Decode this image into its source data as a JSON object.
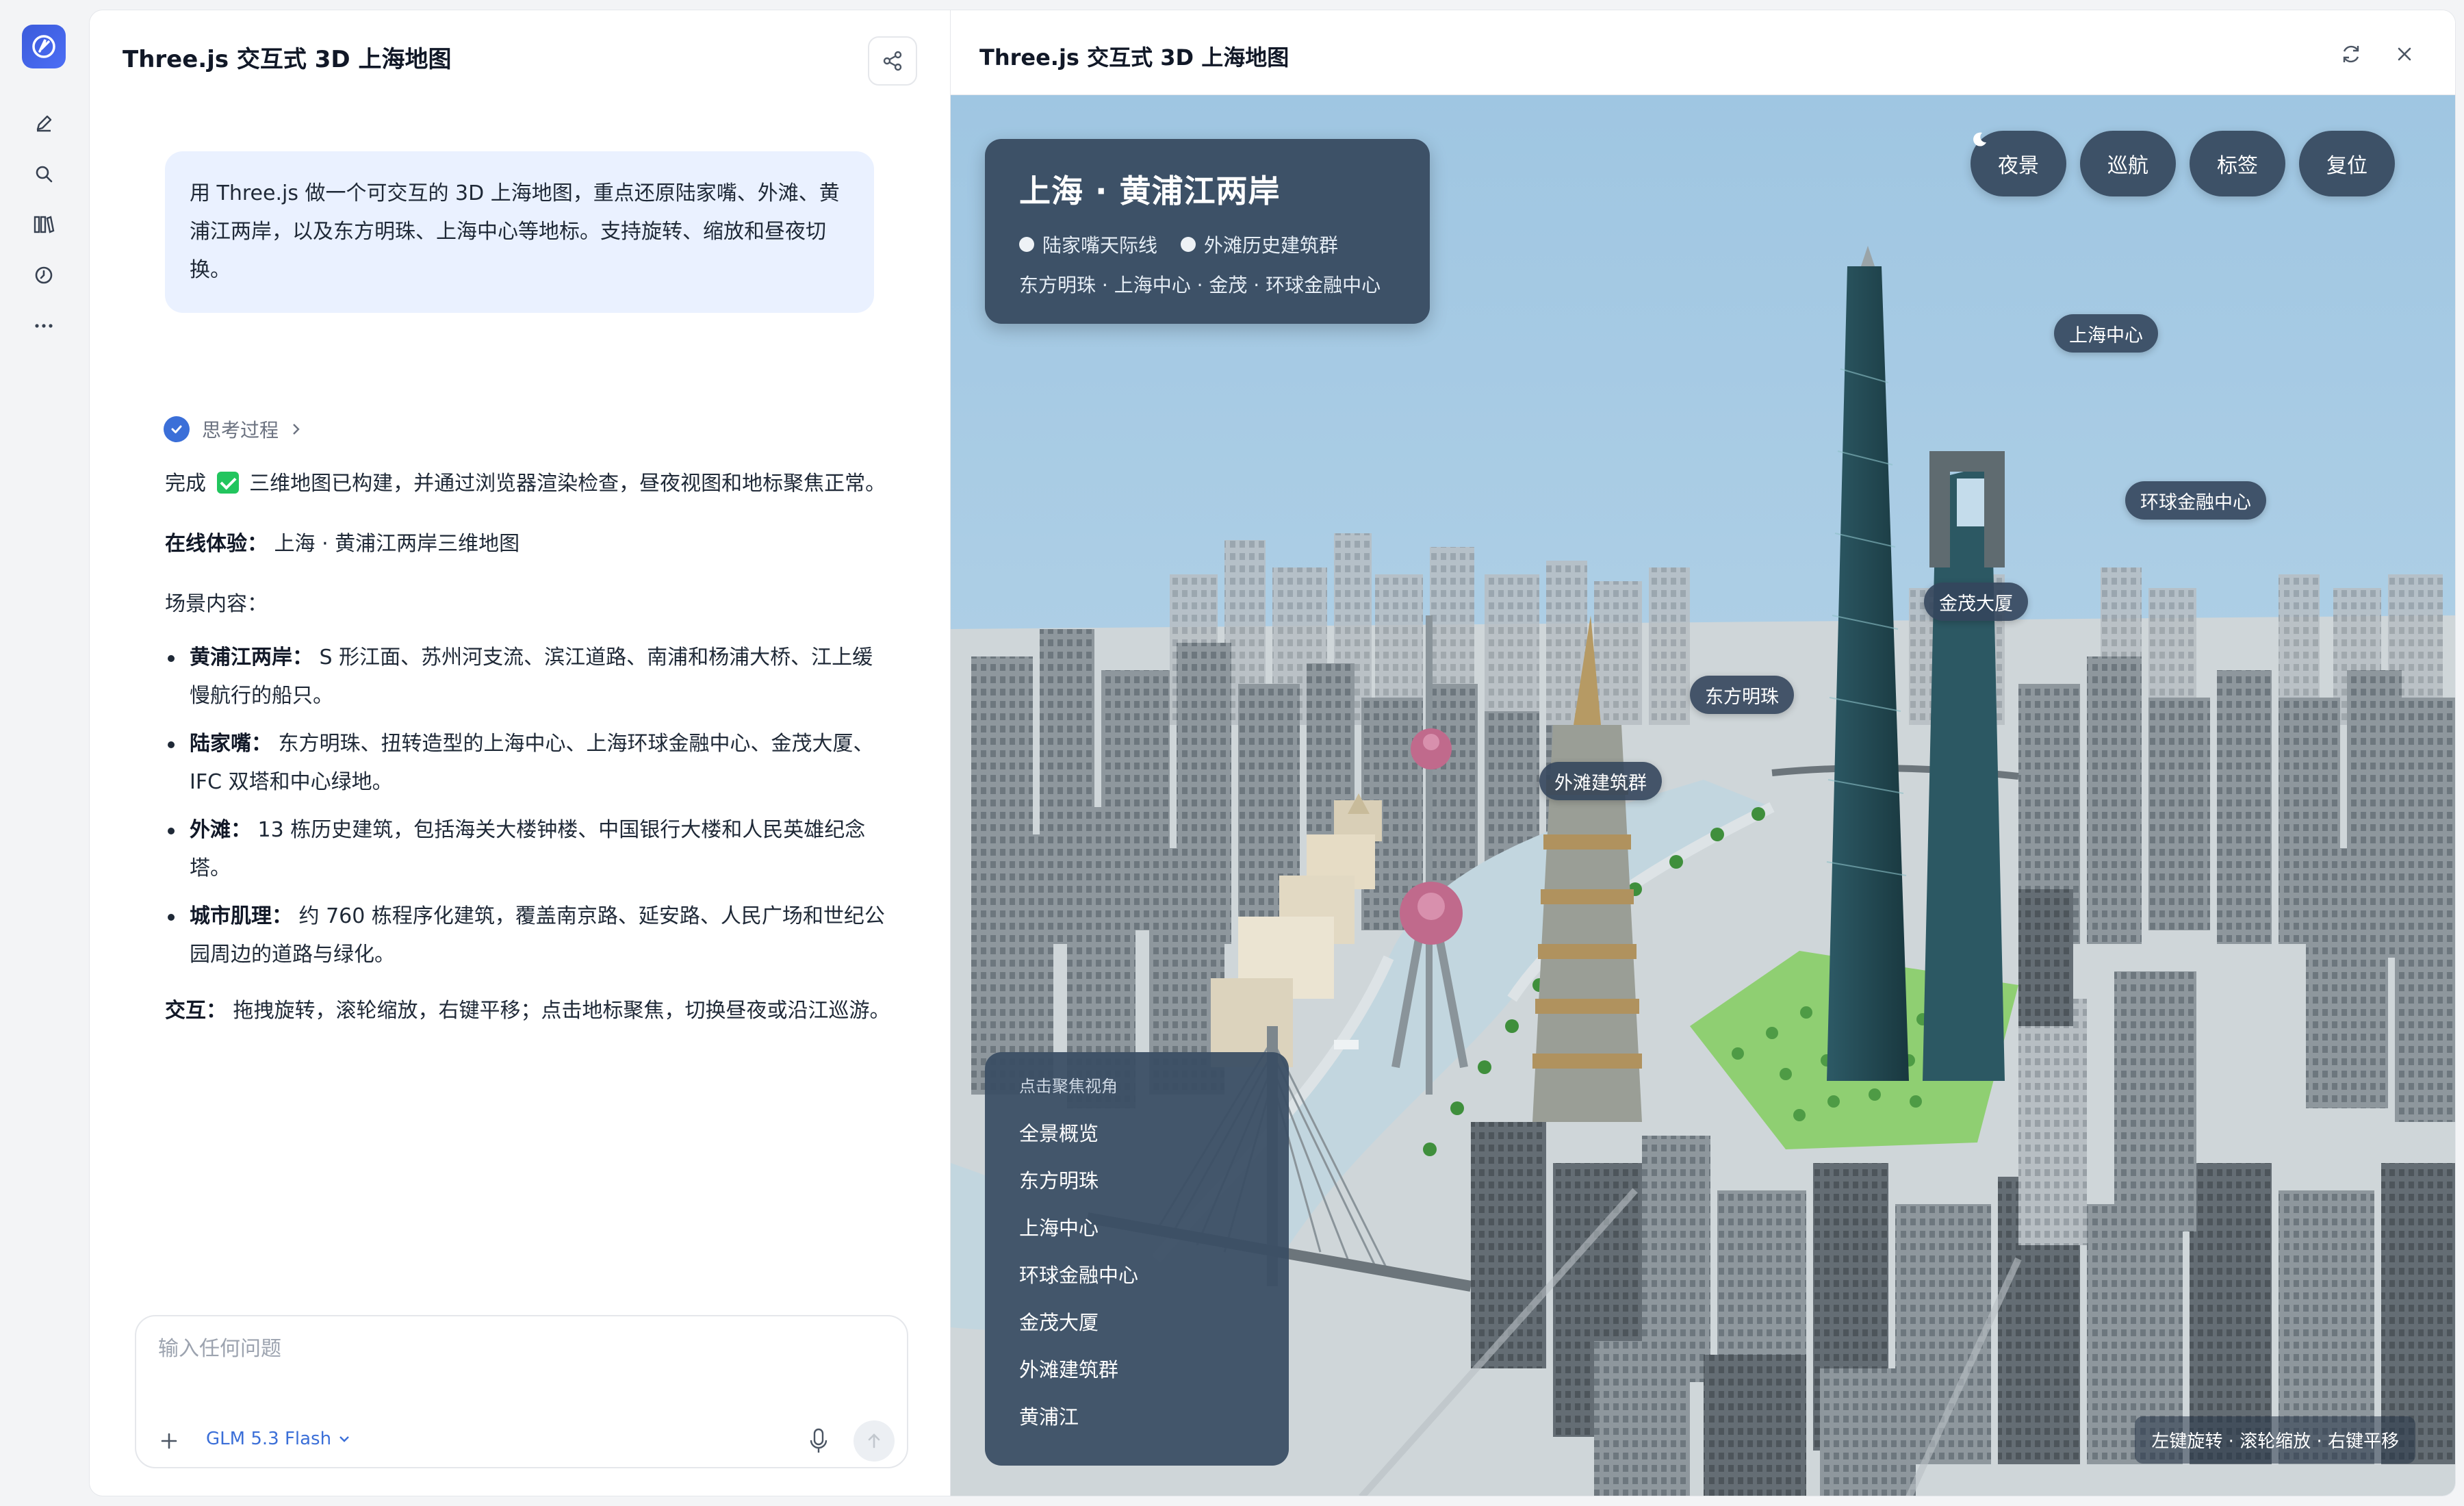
{
  "chat": {
    "title": "Three.js 交互式 3D 上海地图",
    "user_message": "用 Three.js 做一个可交互的 3D 上海地图，重点还原陆家嘴、外滩、黄浦江两岸，以及东方明珠、上海中心等地标。支持旋转、缩放和昼夜切换。",
    "thinking_label": "思考过程",
    "answer": {
      "done_prefix": "完成",
      "done_text": "三维地图已构建，并通过浏览器渲染检查，昼夜视图和地标聚焦正常。",
      "online_label": "在线体验：",
      "online_value": "上海 · 黄浦江两岸三维地图",
      "scene_heading": "场景内容：",
      "bullets": [
        {
          "label": "黄浦江两岸：",
          "text": "S 形江面、苏州河支流、滨江道路、南浦和杨浦大桥、江上缓慢航行的船只。"
        },
        {
          "label": "陆家嘴：",
          "text": "东方明珠、扭转造型的上海中心、上海环球金融中心、金茂大厦、IFC 双塔和中心绿地。"
        },
        {
          "label": "外滩：",
          "text": "13 栋历史建筑，包括海关大楼钟楼、中国银行大楼和人民英雄纪念塔。"
        },
        {
          "label": "城市肌理：",
          "text": "约 760 栋程序化建筑，覆盖南京路、延安路、人民广场和世纪公园周边的道路与绿化。"
        }
      ],
      "interaction_label": "交互：",
      "interaction_text": "拖拽旋转，滚轮缩放，右键平移；点击地标聚焦，切换昼夜或沿江巡游。"
    },
    "composer": {
      "placeholder": "输入任何问题",
      "model": "GLM 5.3 Flash"
    }
  },
  "preview": {
    "title": "Three.js 交互式 3D 上海地图",
    "info_card": {
      "title": "上海 · 黄浦江两岸",
      "legend": [
        "陆家嘴天际线",
        "外滩历史建筑群"
      ],
      "subtitle": "东方明珠 · 上海中心 · 金茂 · 环球金融中心"
    },
    "buttons": [
      "夜景",
      "巡航",
      "标签",
      "复位"
    ],
    "labels": {
      "shanghai_tower": "上海中心",
      "swfc": "环球金融中心",
      "jinmao": "金茂大厦",
      "pearl": "东方明珠",
      "bund": "外滩建筑群"
    },
    "focus_panel": {
      "heading": "点击聚焦视角",
      "items": [
        "全景概览",
        "东方明珠",
        "上海中心",
        "环球金融中心",
        "金茂大厦",
        "外滩建筑群",
        "黄浦江"
      ]
    },
    "hint": "左键旋转 · 滚轮缩放 · 右键平移"
  },
  "colors": {
    "accent": "#3b6fd8",
    "panel": "#34465c",
    "sky": "#a7cbe4",
    "river": "#c4d8e2",
    "park": "#8fcf72"
  }
}
